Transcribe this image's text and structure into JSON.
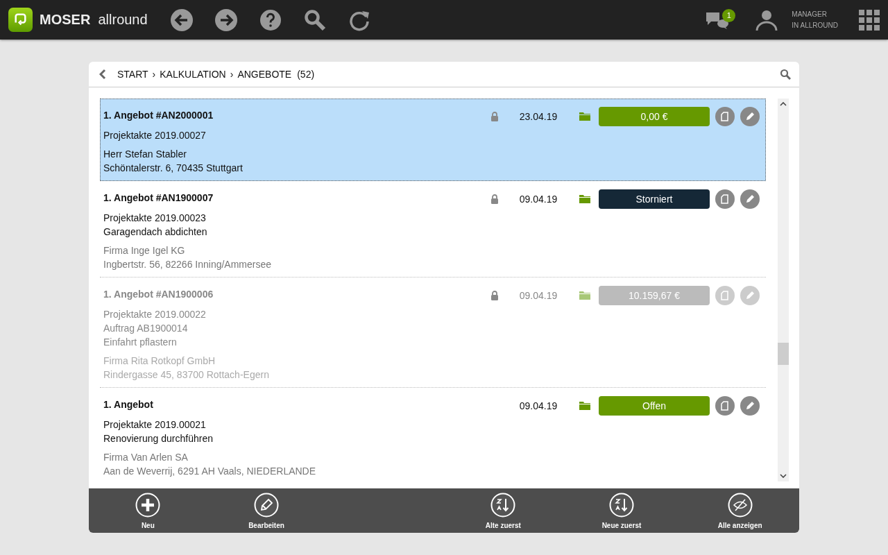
{
  "app": {
    "brand_bold": "MOSER",
    "brand_light": "allround",
    "messages_badge": "1",
    "user_line1": "MANAGER",
    "user_line2": "IN ALLROUND"
  },
  "breadcrumb": {
    "items": [
      "START",
      "KALKULATION",
      "ANGEBOTE"
    ],
    "separator": "›",
    "count": "(52)"
  },
  "offers": [
    {
      "title": "1. Angebot #AN2000001",
      "locked": true,
      "date": "23.04.19",
      "status": {
        "kind": "amount",
        "text": "0,00 €"
      },
      "selected": true,
      "disabled": false,
      "details": [
        "Projektakte 2019.00027"
      ],
      "contact": [
        "Herr Stefan Stabler",
        "Schöntalerstr. 6, 70435 Stuttgart"
      ]
    },
    {
      "title": "1. Angebot #AN1900007",
      "locked": true,
      "date": "09.04.19",
      "status": {
        "kind": "cancelled",
        "text": "Storniert"
      },
      "selected": false,
      "disabled": false,
      "details": [
        "Projektakte 2019.00023",
        "Garagendach abdichten"
      ],
      "contact": [
        "Firma Inge Igel KG",
        "Ingbertstr. 56, 82266 Inning/Ammersee"
      ]
    },
    {
      "title": "1. Angebot #AN1900006",
      "locked": true,
      "date": "09.04.19",
      "status": {
        "kind": "amount",
        "text": "10.159,67 €"
      },
      "selected": false,
      "disabled": true,
      "details": [
        "Projektakte 2019.00022",
        "Auftrag AB1900014",
        "Einfahrt pflastern"
      ],
      "contact": [
        "Firma Rita Rotkopf GmbH",
        "Rindergasse 45, 83700 Rottach-Egern"
      ]
    },
    {
      "title": "1. Angebot",
      "locked": false,
      "date": "09.04.19",
      "status": {
        "kind": "open",
        "text": "Offen"
      },
      "selected": false,
      "disabled": false,
      "details": [
        "Projektakte 2019.00021",
        "Renovierung durchführen"
      ],
      "contact": [
        "Firma Van Arlen SA",
        "Aan de Weverrij, 6291 AH Vaals, NIEDERLANDE"
      ]
    }
  ],
  "toolbar": [
    {
      "kind": "plus",
      "label": "Neu"
    },
    {
      "kind": "pencil",
      "label": "Bearbeiten"
    },
    {
      "kind": "sort-asc",
      "label": "Alte zuerst"
    },
    {
      "kind": "sort-desc",
      "label": "Neue zuerst"
    },
    {
      "kind": "eye",
      "label": "Alle anzeigen"
    }
  ]
}
